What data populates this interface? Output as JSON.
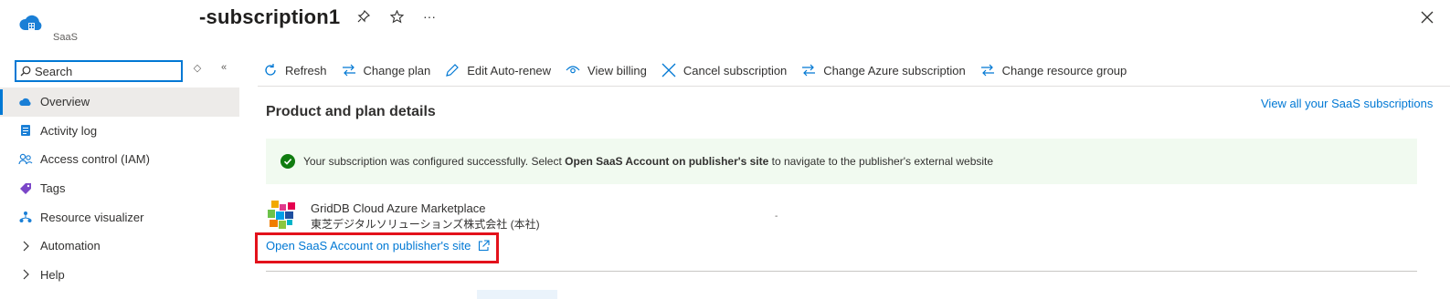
{
  "app": {
    "subtitle": "SaaS",
    "title": "-subscription1"
  },
  "search": {
    "placeholder": "Search"
  },
  "sidebar": {
    "items": [
      {
        "label": "Overview",
        "icon": "cloud-icon"
      },
      {
        "label": "Activity log",
        "icon": "log-icon"
      },
      {
        "label": "Access control (IAM)",
        "icon": "people-icon"
      },
      {
        "label": "Tags",
        "icon": "tag-icon"
      },
      {
        "label": "Resource visualizer",
        "icon": "visualizer-icon"
      },
      {
        "label": "Automation",
        "icon": "chevron-right-icon"
      },
      {
        "label": "Help",
        "icon": "chevron-right-icon"
      }
    ]
  },
  "toolbar": {
    "refresh": "Refresh",
    "change_plan": "Change plan",
    "edit_autorenew": "Edit Auto-renew",
    "view_billing": "View billing",
    "cancel_subscription": "Cancel subscription",
    "change_azure_subscription": "Change Azure subscription",
    "change_resource_group": "Change resource group"
  },
  "main": {
    "section_title": "Product and plan details",
    "view_all_link": "View all your SaaS subscriptions",
    "banner": {
      "text_before": "Your subscription was configured successfully. Select ",
      "text_bold": "Open SaaS Account on publisher's site",
      "text_after": " to navigate to the publisher's external website"
    },
    "offer": {
      "name": "GridDB Cloud Azure Marketplace",
      "publisher": "東芝デジタルソリューションズ株式会社 (本社)",
      "dot": "-"
    },
    "open_link": "Open SaaS Account on publisher's site"
  },
  "colors": {
    "accent": "#0078d4",
    "highlight": "#e3111b",
    "success": "#107c10",
    "banner_bg": "#f1faf0"
  }
}
